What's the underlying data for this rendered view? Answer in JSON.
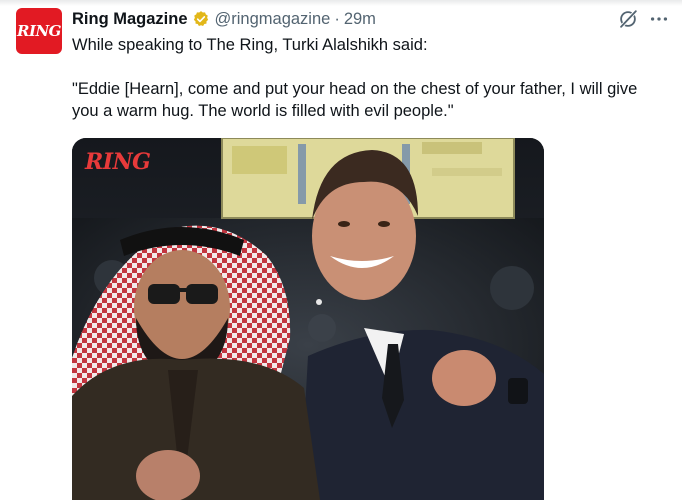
{
  "post": {
    "author_name": "Ring Magazine",
    "avatar_text": "RING",
    "handle": "@ringmagazine",
    "separator": "·",
    "time": "29m",
    "text_intro": "While speaking to The Ring, Turki Alalshikh said:",
    "text_quote": "\"Eddie [Hearn], come and put your head on the chest of your father, I will give you a warm hug. The world is filled with evil people.\""
  },
  "media": {
    "watermark": "RING"
  },
  "icons": {
    "verified": "verified-badge-icon",
    "grok": "grok-icon",
    "more": "more-icon"
  },
  "colors": {
    "brand_red": "#e21a23",
    "verified_gold": "#e2b719",
    "text_secondary": "#536471"
  }
}
